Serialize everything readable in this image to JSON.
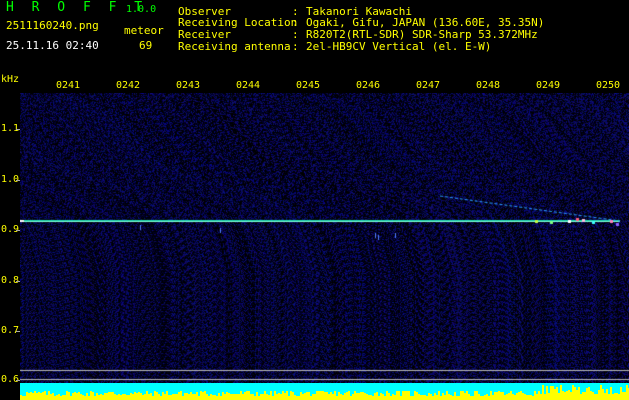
{
  "header": {
    "app_title": "H R O F F T",
    "app_version": "1.0.0",
    "filename": "2511160240.png",
    "timestamp": "25.11.16 02:40",
    "meteor_label": "meteor",
    "meteor_count": "69",
    "info": [
      {
        "key": "Observer",
        "value": "Takanori Kawachi"
      },
      {
        "key": "Receiving Location",
        "value": "Ogaki, Gifu, JAPAN (136.60E, 35.35N)"
      },
      {
        "key": "Receiver",
        "value": "R820T2(RTL-SDR) SDR-Sharp 53.372MHz"
      },
      {
        "key": "Receiving antenna",
        "value": "2el-HB9CV Vertical (el. E-W)"
      }
    ]
  },
  "spectrogram": {
    "y_unit": "kHz",
    "y_ticks": [
      "1.1",
      "1.0",
      "0.9",
      "0.8",
      "0.7",
      "0.6"
    ],
    "x_ticks": [
      "0241",
      "0242",
      "0243",
      "0244",
      "0245",
      "0246",
      "0247",
      "0248",
      "0249",
      "0250"
    ],
    "colors": {
      "background": "#000000",
      "noise": "#101c6a",
      "carrier": "#19d8b0",
      "text_green": "#00ff00",
      "text_yellow": "#ffff00",
      "text_white": "#ffffff",
      "strip_yellow": "#ffff00",
      "strip_cyan": "#00ffff"
    }
  }
}
